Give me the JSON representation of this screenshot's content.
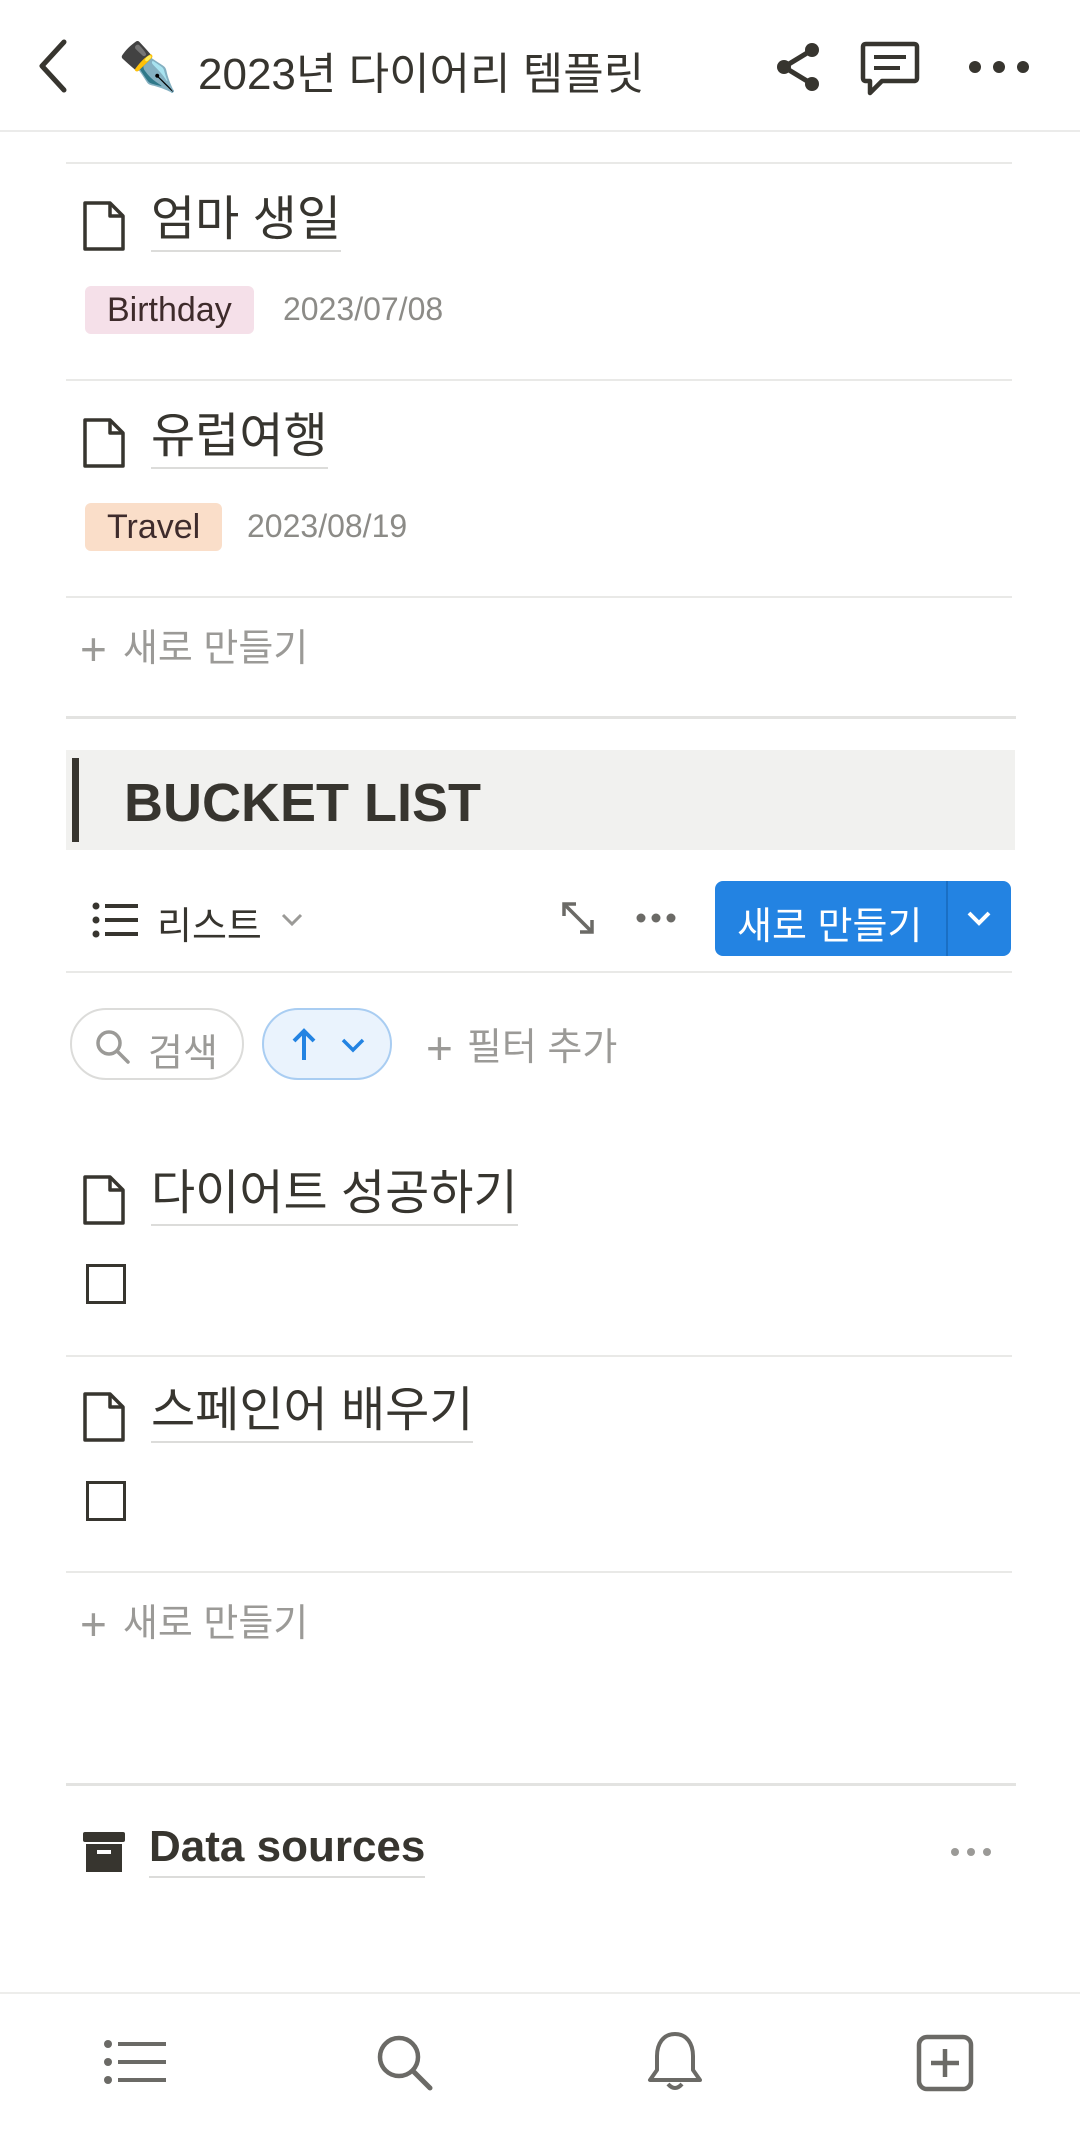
{
  "header": {
    "emoji": "✒️",
    "title": "2023년 다이어리 템플릿"
  },
  "events": {
    "items": [
      {
        "title": "엄마 생일",
        "tag": "Birthday",
        "tag_color": "#f5e0e9",
        "date": "2023/07/08"
      },
      {
        "title": "유럽여행",
        "tag": "Travel",
        "tag_color": "#fadec9",
        "date": "2023/08/19"
      }
    ],
    "new_label": "새로 만들기"
  },
  "bucket": {
    "heading": "BUCKET LIST",
    "view_label": "리스트",
    "new_button": "새로 만들기",
    "search_label": "검색",
    "filter_label": "필터 추가",
    "items": [
      {
        "title": "다이어트 성공하기",
        "checked": false
      },
      {
        "title": "스페인어 배우기",
        "checked": false
      }
    ],
    "new_label": "새로 만들기"
  },
  "data_sources": {
    "label": "Data sources"
  },
  "colors": {
    "accent": "#2383e2",
    "text": "#37352f",
    "muted": "#9b9a97"
  }
}
